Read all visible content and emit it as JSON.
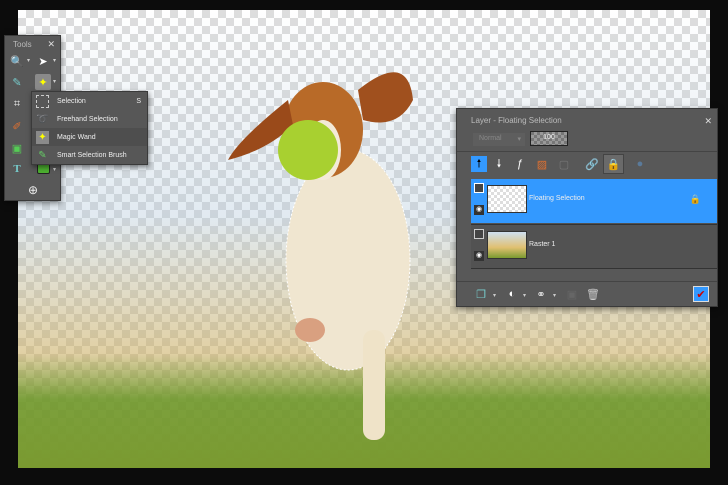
{
  "tools_panel": {
    "title": "Tools",
    "close": "✕",
    "flyout": [
      {
        "label": "Selection",
        "shortcut": "S"
      },
      {
        "label": "Freehand Selection",
        "shortcut": ""
      },
      {
        "label": "Magic Wand",
        "shortcut": ""
      },
      {
        "label": "Smart Selection Brush",
        "shortcut": ""
      }
    ],
    "add": "⊕"
  },
  "layer_panel": {
    "title": "Layer - Floating Selection",
    "close": "✕",
    "blend_mode": "Normal",
    "opacity": "100",
    "layers": [
      {
        "name": "Floating Selection",
        "selected": true
      },
      {
        "name": "Raster 1",
        "selected": false
      }
    ]
  },
  "colors": {
    "accent": "#3399ff",
    "panel": "#585858",
    "fill_swatch": "#4caf30"
  }
}
